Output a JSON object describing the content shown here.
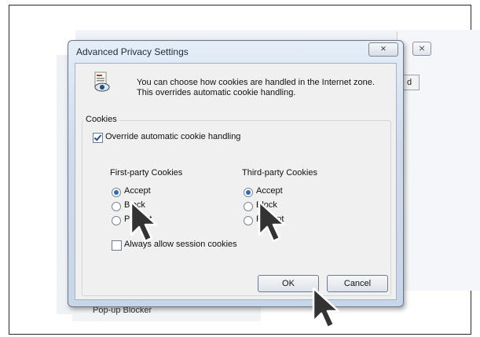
{
  "dialog": {
    "title": "Advanced Privacy Settings",
    "close_label": "⨯",
    "info_text": "You can choose how cookies are handled in the Internet zone.  This overrides automatic cookie handling.",
    "cookies_group_label": "Cookies",
    "override_label": "Override automatic cookie handling",
    "first_party": {
      "heading": "First-party Cookies",
      "options": [
        {
          "label": "Accept",
          "checked": true
        },
        {
          "label": "Block",
          "checked": false
        },
        {
          "label": "Prompt",
          "checked": false
        }
      ]
    },
    "third_party": {
      "heading": "Third-party Cookies",
      "options": [
        {
          "label": "Accept",
          "checked": true
        },
        {
          "label": "Block",
          "checked": false
        },
        {
          "label": "Prompt",
          "checked": false
        }
      ]
    },
    "session_label": "Always allow session cookies",
    "ok_label": "OK",
    "cancel_label": "Cancel"
  },
  "background": {
    "button_label": "d",
    "close_label": "⨯",
    "bottom_label": "Pop-up Blocker"
  }
}
